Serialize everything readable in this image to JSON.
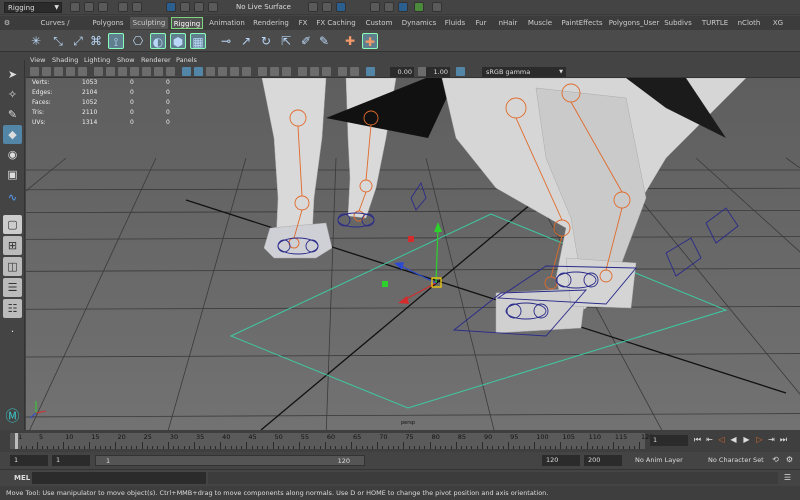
{
  "status_line": {
    "menu_set": "Rigging",
    "live_surface_label": "No Live Surface"
  },
  "shelf_tabs": [
    "Curves / Surfaces",
    "Polygons",
    "Sculpting",
    "Rigging",
    "Animation",
    "Rendering",
    "FX",
    "FX Caching",
    "Custom",
    "Dynamics",
    "Fluids",
    "Fur",
    "nHair",
    "Muscle",
    "PaintEffects",
    "Polygons_User",
    "Subdivs",
    "TURTLE",
    "nCloth",
    "XG"
  ],
  "active_shelf_tab": "Rigging",
  "panel_menu": [
    "View",
    "Shading",
    "Lighting",
    "Show",
    "Renderer",
    "Panels"
  ],
  "panel_toolbar": {
    "exposure": "0.00",
    "gamma": "1.00",
    "color_space": "sRGB gamma"
  },
  "hud": {
    "rows": [
      {
        "label": "Verts:",
        "a": "1053",
        "b": "0",
        "c": "0"
      },
      {
        "label": "Edges:",
        "a": "2104",
        "b": "0",
        "c": "0"
      },
      {
        "label": "Faces:",
        "a": "1052",
        "b": "0",
        "c": "0"
      },
      {
        "label": "Tris:",
        "a": "2110",
        "b": "0",
        "c": "0"
      },
      {
        "label": "UVs:",
        "a": "1314",
        "b": "0",
        "c": "0"
      }
    ]
  },
  "viewport": {
    "camera_label": "persp"
  },
  "time_slider": {
    "ticks": [
      "1",
      "5",
      "10",
      "15",
      "20",
      "25",
      "30",
      "35",
      "40",
      "45",
      "50",
      "55",
      "60",
      "65",
      "70",
      "75",
      "80",
      "85",
      "90",
      "95",
      "100",
      "105",
      "110",
      "115",
      "120"
    ],
    "current_frame": "1"
  },
  "range": {
    "start": "1",
    "anim_start": "1",
    "slider_start": "1",
    "slider_end": "120",
    "anim_end": "120",
    "end": "200",
    "anim_layer": "No Anim Layer",
    "character_set": "No Character Set"
  },
  "command_line": {
    "label": "MEL"
  },
  "help_line": "Move Tool: Use manipulator to move object(s). Ctrl+MMB+drag to move components along normals. Use D or HOME to change the pivot position and axis orientation.",
  "colors": {
    "selection_blue": "#5285a6",
    "joint_orange": "#e06a2a",
    "curve_navy": "#2a2a8a",
    "grid_green": "#3ec9a0"
  },
  "icons": {
    "left_tools": [
      "select-arrow-icon",
      "lasso-icon",
      "paint-select-icon",
      "move-icon",
      "rotate-icon",
      "scale-icon",
      "curve-icon",
      "layout-single-icon",
      "layout-four-icon",
      "layout-two-icon",
      "layout-stack-icon",
      "outliner-icon",
      "maya-logo-icon"
    ]
  }
}
